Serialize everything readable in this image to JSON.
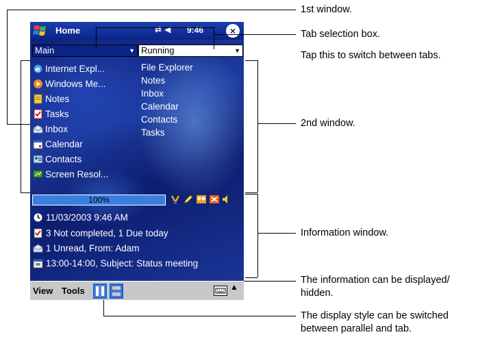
{
  "pda": {
    "title": "Home",
    "clock": "9:46",
    "tray_icons": [
      "connectivity-icon",
      "speaker-icon"
    ],
    "tab_select_1": "Main",
    "tab_select_2": "Running",
    "apps": [
      {
        "label": "Internet Expl...",
        "icon": "internet-explorer-icon"
      },
      {
        "label": "Windows Me...",
        "icon": "windows-media-icon"
      },
      {
        "label": "Notes",
        "icon": "notes-icon"
      },
      {
        "label": "Tasks",
        "icon": "tasks-icon"
      },
      {
        "label": "Inbox",
        "icon": "inbox-icon"
      },
      {
        "label": "Calendar",
        "icon": "calendar-icon"
      },
      {
        "label": "Contacts",
        "icon": "contacts-icon"
      },
      {
        "label": "Screen Resol...",
        "icon": "screen-resolution-icon"
      }
    ],
    "running": [
      "File Explorer",
      "Notes",
      "Inbox",
      "Calendar",
      "Contacts",
      "Tasks"
    ],
    "battery": "100%",
    "info": [
      {
        "text": "11/03/2003 9:46 AM",
        "icon": "clock-icon"
      },
      {
        "text": "3 Not completed, 1 Due today",
        "icon": "tasks-icon"
      },
      {
        "text": "1 Unread, From: Adam",
        "icon": "inbox-icon"
      },
      {
        "text": "13:00-14:00, Subject: Status meeting",
        "icon": "calendar-icon"
      }
    ],
    "menu_view": "View",
    "menu_tools": "Tools"
  },
  "callouts": {
    "first_window": "1st window.",
    "tab_box": "Tab selection box.",
    "tab_tap": "Tap this to switch between tabs.",
    "second_window": "2nd window.",
    "info_window": "Information window.",
    "info_toggle_1": "The information can be displayed/",
    "info_toggle_2": "hidden.",
    "style_1": "The display style can be switched",
    "style_2": "between parallel and tab."
  },
  "colors": {
    "titlebar": "#0a2488",
    "progress": "#3a7fe0",
    "command_bar": "#c8c8c8"
  }
}
